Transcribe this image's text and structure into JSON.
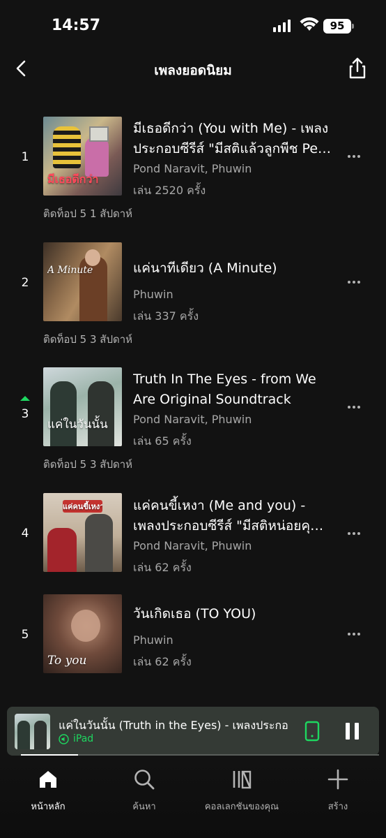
{
  "status": {
    "time": "14:57",
    "battery": "95"
  },
  "header": {
    "title": "เพลงยอดนิยม"
  },
  "tracks": [
    {
      "rank": "1",
      "title": "มีเธอดีกว่า (You with Me) - เพลงประกอบซีรีส์ \"มีสติแล้วลูกพีช Pe…",
      "artist": "Pond Naravit, Phuwin",
      "plays": "เล่น 2520 ครั้ง",
      "weeks": "ติดท็อป 5 1 สัปดาห์",
      "art_caption": "มีเธอดีกว่า",
      "trend": "none"
    },
    {
      "rank": "2",
      "title": "แค่นาทีเดียว (A Minute)",
      "artist": "Phuwin",
      "plays": "เล่น 337 ครั้ง",
      "weeks": "ติดท็อป 5 3 สัปดาห์",
      "art_caption": "A Minute",
      "trend": "none"
    },
    {
      "rank": "3",
      "title": "Truth In The Eyes - from We Are Original Soundtrack",
      "artist": "Pond Naravit, Phuwin",
      "plays": "เล่น 65 ครั้ง",
      "weeks": "ติดท็อป 5 3 สัปดาห์",
      "art_caption": "แค่ในวันนั้น",
      "trend": "up"
    },
    {
      "rank": "4",
      "title": "แค่คนขี้เหงา (Me and you) - เพลงประกอบซีรีส์ \"มีสติหน่อยคุ…",
      "artist": "Pond Naravit, Phuwin",
      "plays": "เล่น 62 ครั้ง",
      "weeks": "",
      "art_caption": "แค่คนขี้เหงา",
      "trend": "none"
    },
    {
      "rank": "5",
      "title": "วันเกิดเธอ (TO YOU)",
      "artist": "Phuwin",
      "plays": "เล่น 62 ครั้ง",
      "weeks": "",
      "art_caption": "To you",
      "trend": "none"
    }
  ],
  "player": {
    "title": "แค่ในวันนั้น (Truth in the Eyes) - เพลงประกอบซี",
    "device": "iPad",
    "progress": 0.16
  },
  "nav": {
    "home": "หน้าหลัก",
    "search": "ค้นหา",
    "library": "คอลเลกชันของคุณ",
    "create": "สร้าง"
  },
  "colors": {
    "accent": "#1ed760",
    "background": "#121212",
    "player": "#343a35"
  }
}
